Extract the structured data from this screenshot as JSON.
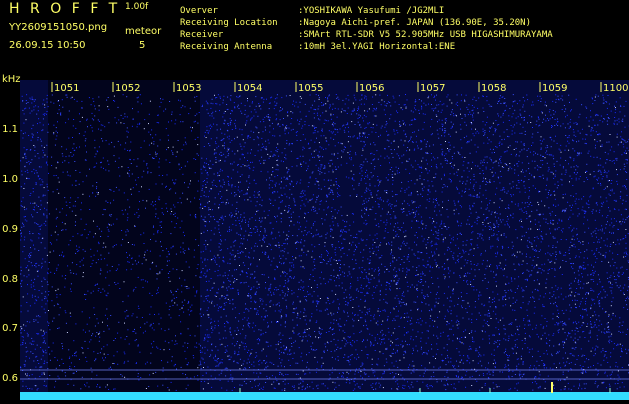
{
  "header": {
    "app_title": "HROFFT",
    "version": "1.00f",
    "filename": "YY2609151050.png",
    "timestamp": "26.09.15 10:50",
    "meteor_label": "meteor",
    "meteor_count": "5"
  },
  "info": [
    {
      "key": "Overver",
      "value": ":YOSHIKAWA Yasufumi /JG2MLI"
    },
    {
      "key": "Receiving Location",
      "value": ":Nagoya Aichi-pref. JAPAN (136.90E, 35.20N)"
    },
    {
      "key": "Receiver",
      "value": ":SMArt RTL-SDR V5 52.905MHz USB HIGASHIMURAYAMA"
    },
    {
      "key": "Receiving Antenna",
      "value": ":10mH 3el.YAGI Horizontal:ENE"
    }
  ],
  "axes": {
    "y_unit": "kHz",
    "y_ticks": [
      "1.1",
      "1.0",
      "0.9",
      "0.8",
      "0.7",
      "0.6"
    ],
    "x_ticks": [
      "1051",
      "1052",
      "1053",
      "1054",
      "1055",
      "1056",
      "1057",
      "1058",
      "1059",
      "1100"
    ]
  },
  "colors": {
    "text": "#ffff66",
    "background": "#000000",
    "noise_blue": "#1a2cff",
    "baseline": "#33ddff"
  }
}
